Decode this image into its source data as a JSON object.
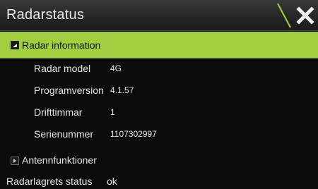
{
  "header": {
    "title": "Radarstatus"
  },
  "radar_information": {
    "label": "Radar information",
    "expanded": true,
    "rows": [
      {
        "label": "Radar model",
        "value": "4G"
      },
      {
        "label": "Programversion",
        "value": "4.1.57"
      },
      {
        "label": "Drifttimmar",
        "value": "1"
      },
      {
        "label": "Serienummer",
        "value": "1107302997"
      }
    ]
  },
  "antenna_functions": {
    "label": "Antennfunktioner",
    "expanded": false
  },
  "status_row": {
    "label": "Radarlagrets status",
    "value": "ok"
  },
  "icons": {
    "slash": "diagonal-slash-icon",
    "close": "close-icon"
  },
  "colors": {
    "accent": "#a3cf3f",
    "background": "#0b0b0b",
    "titlebar": "#2a2a2a"
  }
}
